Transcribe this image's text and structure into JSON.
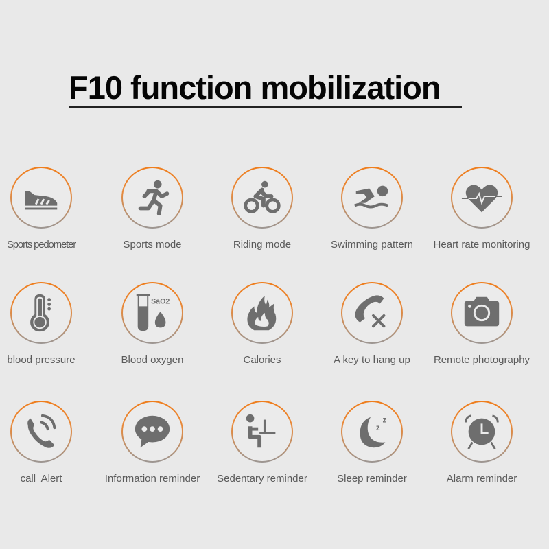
{
  "header": {
    "title": "F10 function mobilization"
  },
  "colors": {
    "ring_top": "#ef7d1c",
    "ring_bottom": "#9c9693",
    "icon": "#6e6e6e",
    "label": "#5a5a5a",
    "background": "#e9e9e9"
  },
  "features": [
    {
      "label": "Sports pedometer",
      "icon": "sneaker-icon"
    },
    {
      "label": "Sports mode",
      "icon": "running-person-icon"
    },
    {
      "label": "Riding mode",
      "icon": "cyclist-icon"
    },
    {
      "label": "Swimming pattern",
      "icon": "swimmer-icon"
    },
    {
      "label": "Heart rate monitoring",
      "icon": "heart-pulse-icon"
    },
    {
      "label": "blood pressure",
      "icon": "thermometer-icon"
    },
    {
      "label": "Blood oxygen",
      "icon": "test-tube-drop-icon",
      "icon_text": "SaO2"
    },
    {
      "label": "Calories",
      "icon": "flame-icon"
    },
    {
      "label": "A key to hang up",
      "icon": "phone-hangup-icon"
    },
    {
      "label": "Remote photography",
      "icon": "camera-icon"
    },
    {
      "label": "call  Alert",
      "icon": "phone-ringing-icon"
    },
    {
      "label": "Information reminder",
      "icon": "chat-bubble-icon"
    },
    {
      "label": "Sedentary reminder",
      "icon": "sitting-person-icon"
    },
    {
      "label": "Sleep reminder",
      "icon": "moon-zzz-icon"
    },
    {
      "label": "Alarm reminder",
      "icon": "alarm-clock-icon"
    }
  ]
}
